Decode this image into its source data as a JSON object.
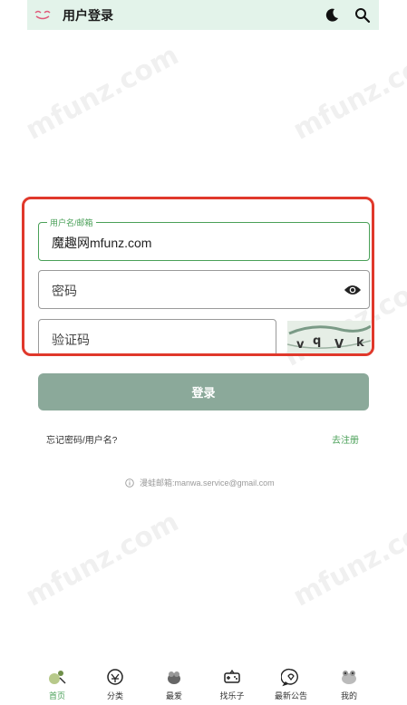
{
  "header": {
    "title": "用户登录",
    "logo_icon": "logo-icon",
    "theme_icon": "moon-icon",
    "search_icon": "search-icon"
  },
  "watermark": "mfunz.com",
  "form": {
    "username": {
      "label": "用户名/邮箱",
      "value": "魔趣网mfunz.com"
    },
    "password": {
      "placeholder": "密码",
      "toggle_icon": "eye-icon"
    },
    "captcha": {
      "placeholder": "验证码",
      "image_text": "vqVk"
    }
  },
  "login_button": "登录",
  "forgot_link": "忘记密码/用户名?",
  "register_link": "去注册",
  "contact": {
    "icon": "info-icon",
    "text": "漫蛙邮箱:manwa.service@gmail.com"
  },
  "nav": {
    "items": [
      {
        "label": "首页",
        "icon": "home-icon",
        "active": true
      },
      {
        "label": "分类",
        "icon": "category-icon",
        "active": false
      },
      {
        "label": "最爱",
        "icon": "favorite-icon",
        "active": false
      },
      {
        "label": "找乐子",
        "icon": "game-icon",
        "active": false
      },
      {
        "label": "最新公告",
        "icon": "announcement-icon",
        "active": false
      },
      {
        "label": "我的",
        "icon": "profile-icon",
        "active": false
      }
    ]
  },
  "colors": {
    "accent": "#4aa058",
    "header_bg": "#e3f3ea",
    "button_bg": "#8ba99a",
    "highlight": "#e0382b"
  }
}
